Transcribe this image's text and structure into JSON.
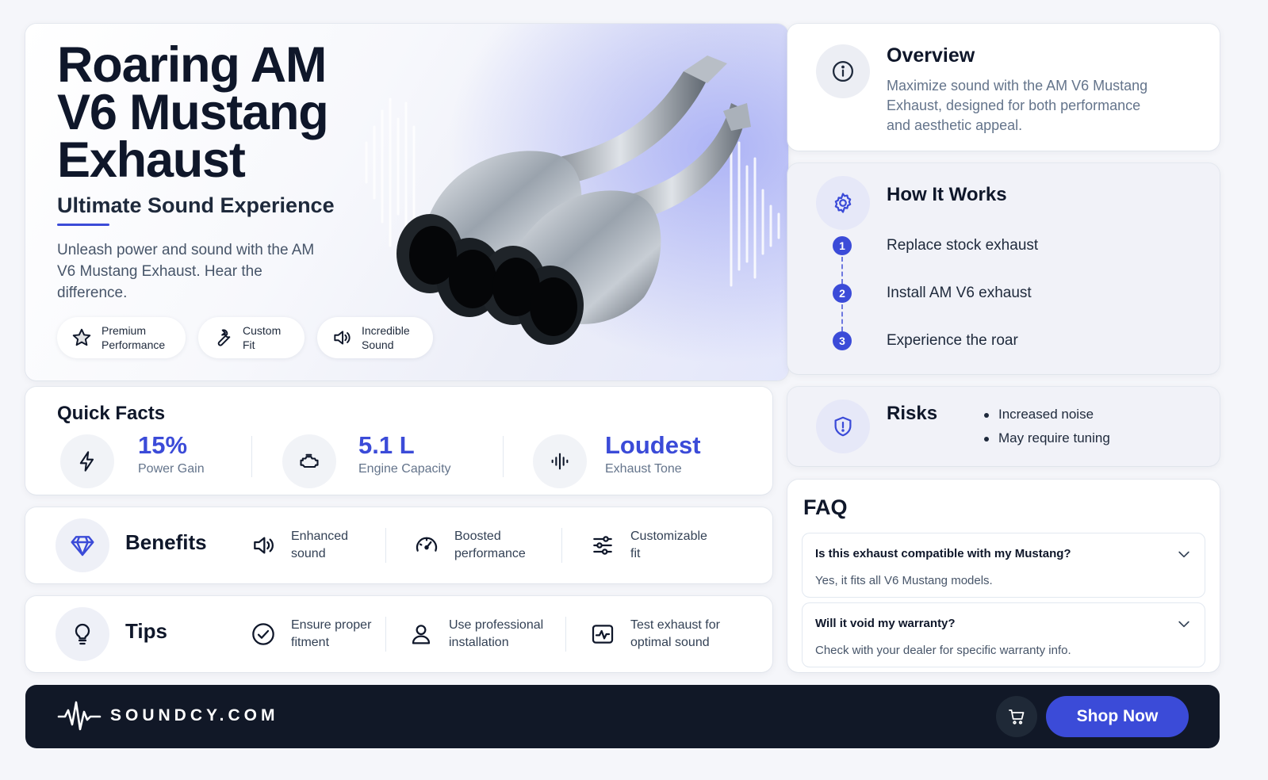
{
  "hero": {
    "title": "Roaring AM V6 Mustang Exhaust",
    "subtitle": "Ultimate Sound Experience",
    "description": "Unleash power and sound with the AM V6 Mustang Exhaust. Hear the difference.",
    "chips": [
      {
        "label": "Premium Performance",
        "icon": "star-icon"
      },
      {
        "label": "Custom Fit",
        "icon": "wrench-icon"
      },
      {
        "label": "Incredible Sound",
        "icon": "speaker-icon"
      }
    ]
  },
  "overview": {
    "title": "Overview",
    "text": "Maximize sound with the AM V6 Mustang Exhaust, designed for both performance and aesthetic appeal.",
    "icon": "info-icon"
  },
  "how_it_works": {
    "title": "How It Works",
    "icon": "gear-icon",
    "steps": [
      {
        "num": "1",
        "text": "Replace stock exhaust"
      },
      {
        "num": "2",
        "text": "Install AM V6 exhaust"
      },
      {
        "num": "3",
        "text": "Experience the roar"
      }
    ]
  },
  "risks": {
    "title": "Risks",
    "icon": "shield-alert-icon",
    "items": [
      "Increased noise",
      "May require tuning"
    ]
  },
  "faq": {
    "title": "FAQ",
    "items": [
      {
        "q": "Is this exhaust compatible with my Mustang?",
        "a": "Yes, it fits all V6 Mustang models."
      },
      {
        "q": "Will it void my warranty?",
        "a": "Check with your dealer for specific warranty info."
      }
    ]
  },
  "quick_facts": {
    "title": "Quick Facts",
    "items": [
      {
        "value": "15%",
        "label": "Power Gain",
        "icon": "lightning-icon"
      },
      {
        "value": "5.1 L",
        "label": "Engine Capacity",
        "icon": "engine-icon"
      },
      {
        "value": "Loudest",
        "label": "Exhaust Tone",
        "icon": "soundwave-icon"
      }
    ]
  },
  "benefits": {
    "title": "Benefits",
    "icon": "diamond-icon",
    "items": [
      {
        "line1": "Enhanced",
        "line2": "sound",
        "icon": "speaker-icon"
      },
      {
        "line1": "Boosted",
        "line2": "performance",
        "icon": "speedometer-icon"
      },
      {
        "line1": "Customizable",
        "line2": "fit",
        "icon": "sliders-icon"
      }
    ]
  },
  "tips": {
    "title": "Tips",
    "icon": "lightbulb-icon",
    "items": [
      {
        "line1": "Ensure proper",
        "line2": "fitment",
        "icon": "check-circle-icon"
      },
      {
        "line1": "Use professional",
        "line2": "installation",
        "icon": "user-icon"
      },
      {
        "line1": "Test exhaust for",
        "line2": "optimal sound",
        "icon": "pulse-icon"
      }
    ]
  },
  "footer": {
    "brand": "SOUNDCY.COM",
    "cta": "Shop Now",
    "cart_icon": "cart-icon"
  },
  "colors": {
    "accent": "#3b4bd8",
    "footer_bg": "#111827",
    "page_bg": "#f5f6fa"
  }
}
